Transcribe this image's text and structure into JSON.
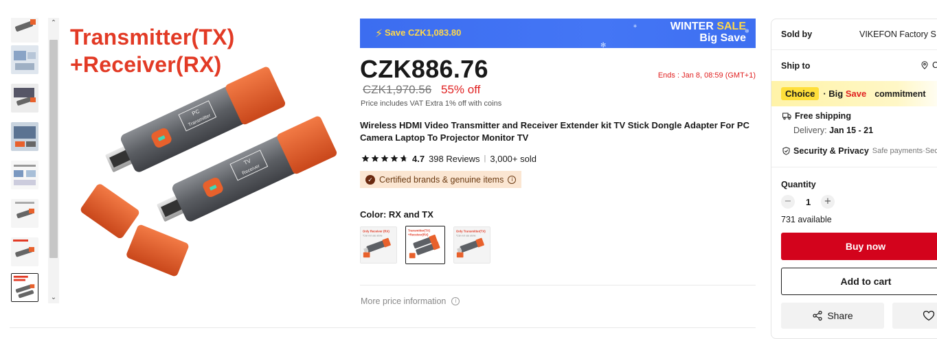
{
  "thumbnails": [
    {
      "name": "thumb-1"
    },
    {
      "name": "thumb-2"
    },
    {
      "name": "thumb-3"
    },
    {
      "name": "thumb-4"
    },
    {
      "name": "thumb-5"
    },
    {
      "name": "thumb-6"
    },
    {
      "name": "thumb-7"
    },
    {
      "name": "thumb-8"
    }
  ],
  "main_image": {
    "headline_line1": "Transmitter(TX)",
    "headline_line2": "+Receiver(RX)",
    "tx_label_line1": "PC",
    "tx_label_line2": "Transmitter",
    "rx_label_line1": "TV",
    "rx_label_line2": "Receiver"
  },
  "sale_banner": {
    "save_text": "Save CZK1,083.80",
    "event_word1": "WINTER",
    "event_word2": "SALE",
    "event_line2": "Big Save"
  },
  "pricing": {
    "current_price": "CZK886.76",
    "ends_text": "Ends :  Jan 8, 08:59 (GMT+1)",
    "original_price": "CZK1,970.56",
    "discount": "55% off",
    "vat_note": "Price includes VAT Extra 1% off with coins"
  },
  "product": {
    "title": "Wireless HDMI Video Transmitter and Receiver Extender kit TV Stick Dongle Adapter For PC Camera Laptop To Projector Monitor TV",
    "rating": "4.7",
    "stars_value": 4.7,
    "reviews": "398 Reviews",
    "sold": "3,000+ sold",
    "certified_text": "Certified brands & genuine items"
  },
  "color": {
    "label": "Color:",
    "selected": "RX and TX",
    "options": [
      {
        "caption": "Only Receiver (RX)",
        "sub": "*Can not use alone"
      },
      {
        "caption": "Transmitter(TX)",
        "sub": "+Receiver(RX)"
      },
      {
        "caption": "Only Transmitter(TX)",
        "sub": "*Can not use alone"
      }
    ]
  },
  "more_price_info": "More price information",
  "sidebar": {
    "sold_by_label": "Sold by",
    "sold_by_value": "VIKEFON Factory S",
    "ship_to_label": "Ship to",
    "ship_to_value": "C",
    "choice_tag": "Choice",
    "choice_mid_prefix": "· Big ",
    "choice_mid_save": "Save",
    "choice_commitment": "commitment",
    "free_shipping": "Free shipping",
    "delivery_label": "Delivery:",
    "delivery_dates": "Jan 15 - 21",
    "security_label": "Security & Privacy",
    "security_sub": "Safe payments·Secur",
    "quantity_label": "Quantity",
    "quantity_value": "1",
    "available": "731 available",
    "buy_now": "Buy now",
    "add_to_cart": "Add to cart",
    "share": "Share"
  },
  "colors": {
    "accent_red": "#d3031c",
    "price_red": "#e02020",
    "banner_blue": "#3c6df0",
    "choice_yellow": "#ffdf3a",
    "certified_bg": "#fbe6d2"
  }
}
